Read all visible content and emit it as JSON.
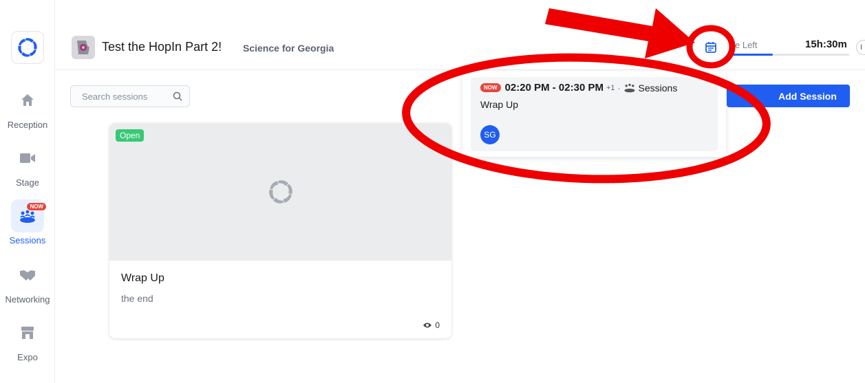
{
  "app": {
    "event_title": "Test the HopIn Part 2!",
    "organization": "Science for Georgia"
  },
  "sidebar": {
    "items": [
      {
        "label": "Reception",
        "icon": "home-icon"
      },
      {
        "label": "Stage",
        "icon": "video-camera-icon"
      },
      {
        "label": "Sessions",
        "icon": "sessions-icon",
        "badge": "NOW",
        "active": true
      },
      {
        "label": "Networking",
        "icon": "handshake-icon"
      },
      {
        "label": "Expo",
        "icon": "store-icon"
      }
    ]
  },
  "header": {
    "time_left_label": "e Left",
    "time_left_value": "15h:30m",
    "time_progress_fraction": 0.37,
    "edge_button_label": "I",
    "calendar_icon": "calendar-icon"
  },
  "search": {
    "placeholder": "Search sessions"
  },
  "session_card": {
    "status_badge": "Open",
    "title": "Wrap Up",
    "description": "the end",
    "view_count": "0"
  },
  "popover": {
    "now_badge": "NOW",
    "time_range": "02:20 PM - 02:30 PM",
    "extra_count": "+1",
    "separator": "·",
    "category": "Sessions",
    "title": "Wrap Up",
    "avatar_initials": "SG"
  },
  "actions": {
    "add_session_label": "Add Session"
  },
  "colors": {
    "accent": "#1f5ef0",
    "now_red": "#e8453c",
    "open_green": "#38c976",
    "annotation_red": "#ee0000"
  }
}
